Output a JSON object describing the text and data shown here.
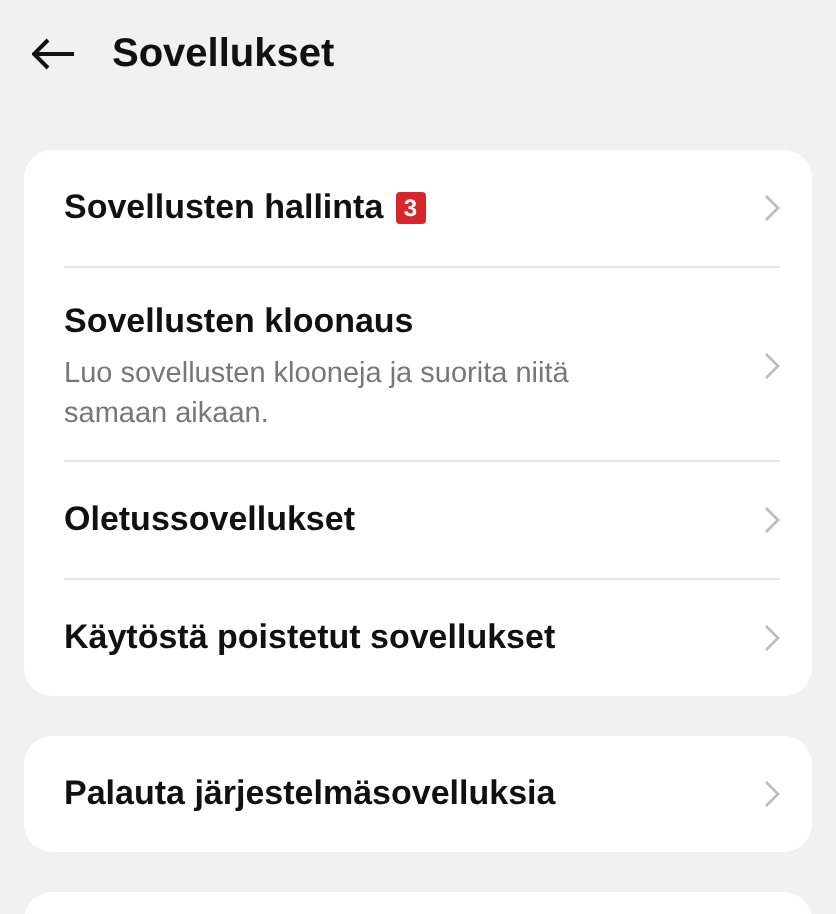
{
  "header": {
    "title": "Sovellukset"
  },
  "groups": [
    {
      "items": [
        {
          "title": "Sovellusten hallinta",
          "badge": "3"
        },
        {
          "title": "Sovellusten kloonaus",
          "subtitle": "Luo sovellusten klooneja ja suorita niitä samaan aikaan."
        },
        {
          "title": "Oletussovellukset"
        },
        {
          "title": "Käytöstä poistetut sovellukset"
        }
      ]
    },
    {
      "items": [
        {
          "title": "Palauta järjestelmäsovelluksia"
        }
      ]
    }
  ]
}
